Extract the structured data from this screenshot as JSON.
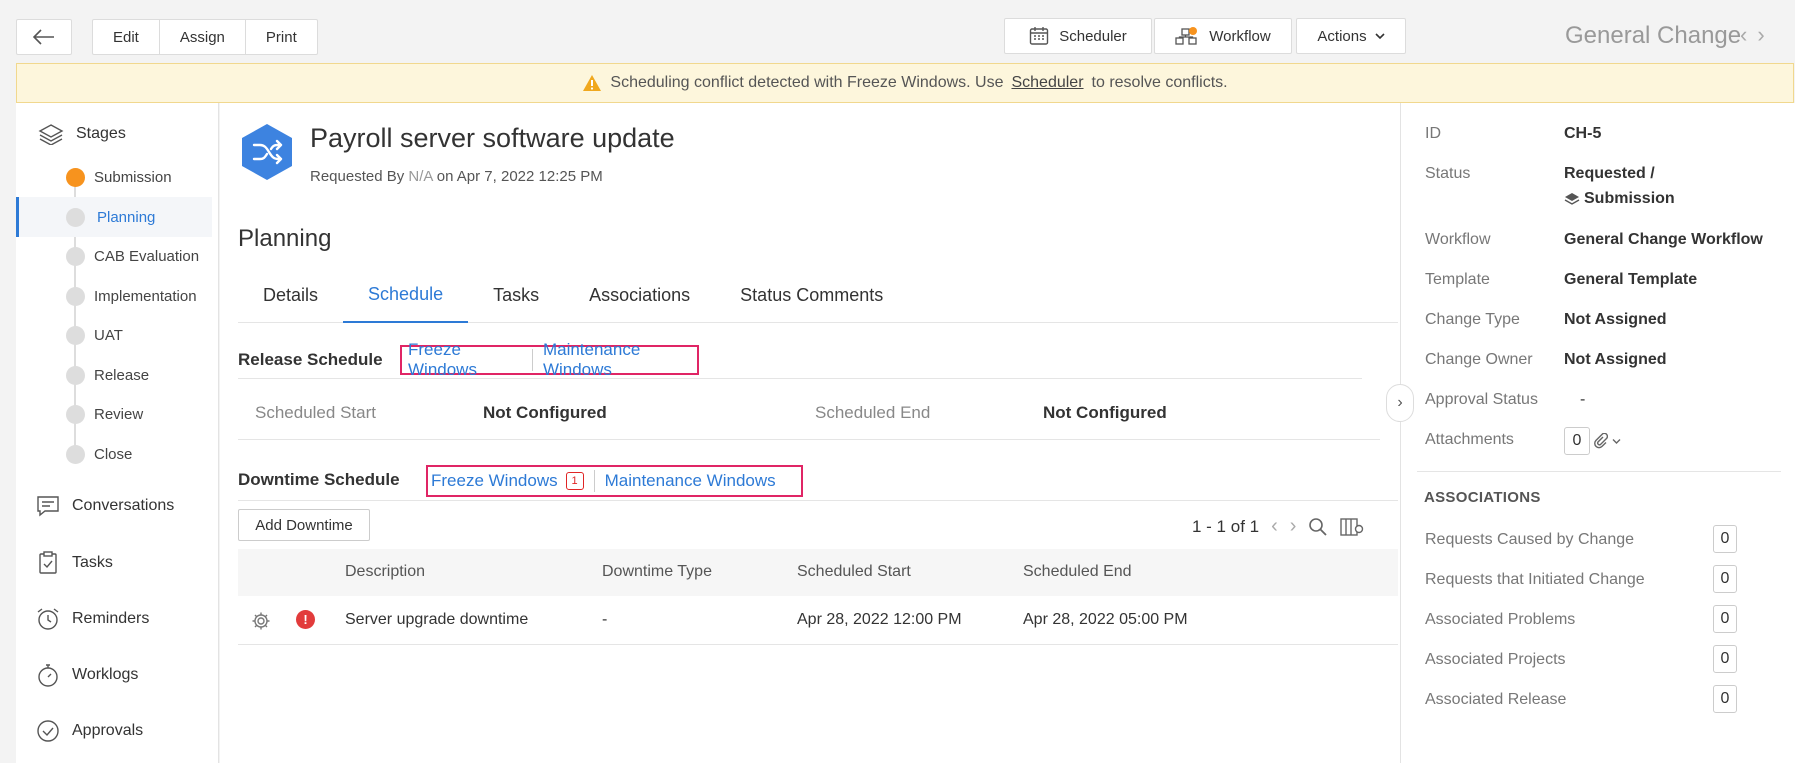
{
  "toolbar": {
    "edit": "Edit",
    "assign": "Assign",
    "print": "Print",
    "scheduler": "Scheduler",
    "workflow": "Workflow",
    "actions": "Actions",
    "template_title": "General Change"
  },
  "banner": {
    "prefix": "Scheduling conflict detected with Freeze Windows. Use",
    "link": "Scheduler",
    "suffix": "to resolve conflicts."
  },
  "leftnav": {
    "stages_label": "Stages",
    "stages": [
      "Submission",
      "Planning",
      "CAB Evaluation",
      "Implementation",
      "UAT",
      "Release",
      "Review",
      "Close"
    ],
    "active_stage": "Planning",
    "items": [
      "Conversations",
      "Tasks",
      "Reminders",
      "Worklogs",
      "Approvals"
    ]
  },
  "request": {
    "title": "Payroll server software update",
    "requested_by_label": "Requested By",
    "requested_by": "N/A",
    "on_date": "on Apr 7, 2022 12:25 PM"
  },
  "section_title": "Planning",
  "tabs": [
    "Details",
    "Schedule",
    "Tasks",
    "Associations",
    "Status Comments"
  ],
  "release_schedule": {
    "label": "Release Schedule",
    "freeze": "Freeze Windows",
    "maintenance": "Maintenance Windows",
    "start_label": "Scheduled Start",
    "start_value": "Not Configured",
    "end_label": "Scheduled End",
    "end_value": "Not Configured"
  },
  "downtime_schedule": {
    "label": "Downtime Schedule",
    "freeze": "Freeze Windows",
    "freeze_count": "1",
    "maintenance": "Maintenance Windows",
    "add_button": "Add Downtime",
    "pager": "1 - 1 of 1",
    "columns": [
      "Description",
      "Downtime Type",
      "Scheduled Start",
      "Scheduled End"
    ],
    "rows": [
      {
        "description": "Server upgrade downtime",
        "type": "-",
        "start": "Apr 28, 2022 12:00 PM",
        "end": "Apr 28, 2022 05:00 PM"
      }
    ]
  },
  "properties": {
    "id_label": "ID",
    "id": "CH-5",
    "status_label": "Status",
    "status": "Requested /",
    "status_stage": "Submission",
    "workflow_label": "Workflow",
    "workflow": "General Change Workflow",
    "template_label": "Template",
    "template": "General Template",
    "change_type_label": "Change Type",
    "change_type": "Not Assigned",
    "change_owner_label": "Change Owner",
    "change_owner": "Not Assigned",
    "approval_label": "Approval Status",
    "approval": "-",
    "attachments_label": "Attachments",
    "attachments": "0"
  },
  "associations": {
    "heading": "ASSOCIATIONS",
    "items": [
      {
        "label": "Requests Caused by Change",
        "count": "0"
      },
      {
        "label": "Requests that Initiated Change",
        "count": "0"
      },
      {
        "label": "Associated Problems",
        "count": "0"
      },
      {
        "label": "Associated Projects",
        "count": "0"
      },
      {
        "label": "Associated Release",
        "count": "0"
      }
    ]
  },
  "colors": {
    "accent": "#2d7ad6",
    "highlight": "#e02565",
    "stage_active": "#f7931e",
    "banner_bg": "#fdf6dc"
  }
}
